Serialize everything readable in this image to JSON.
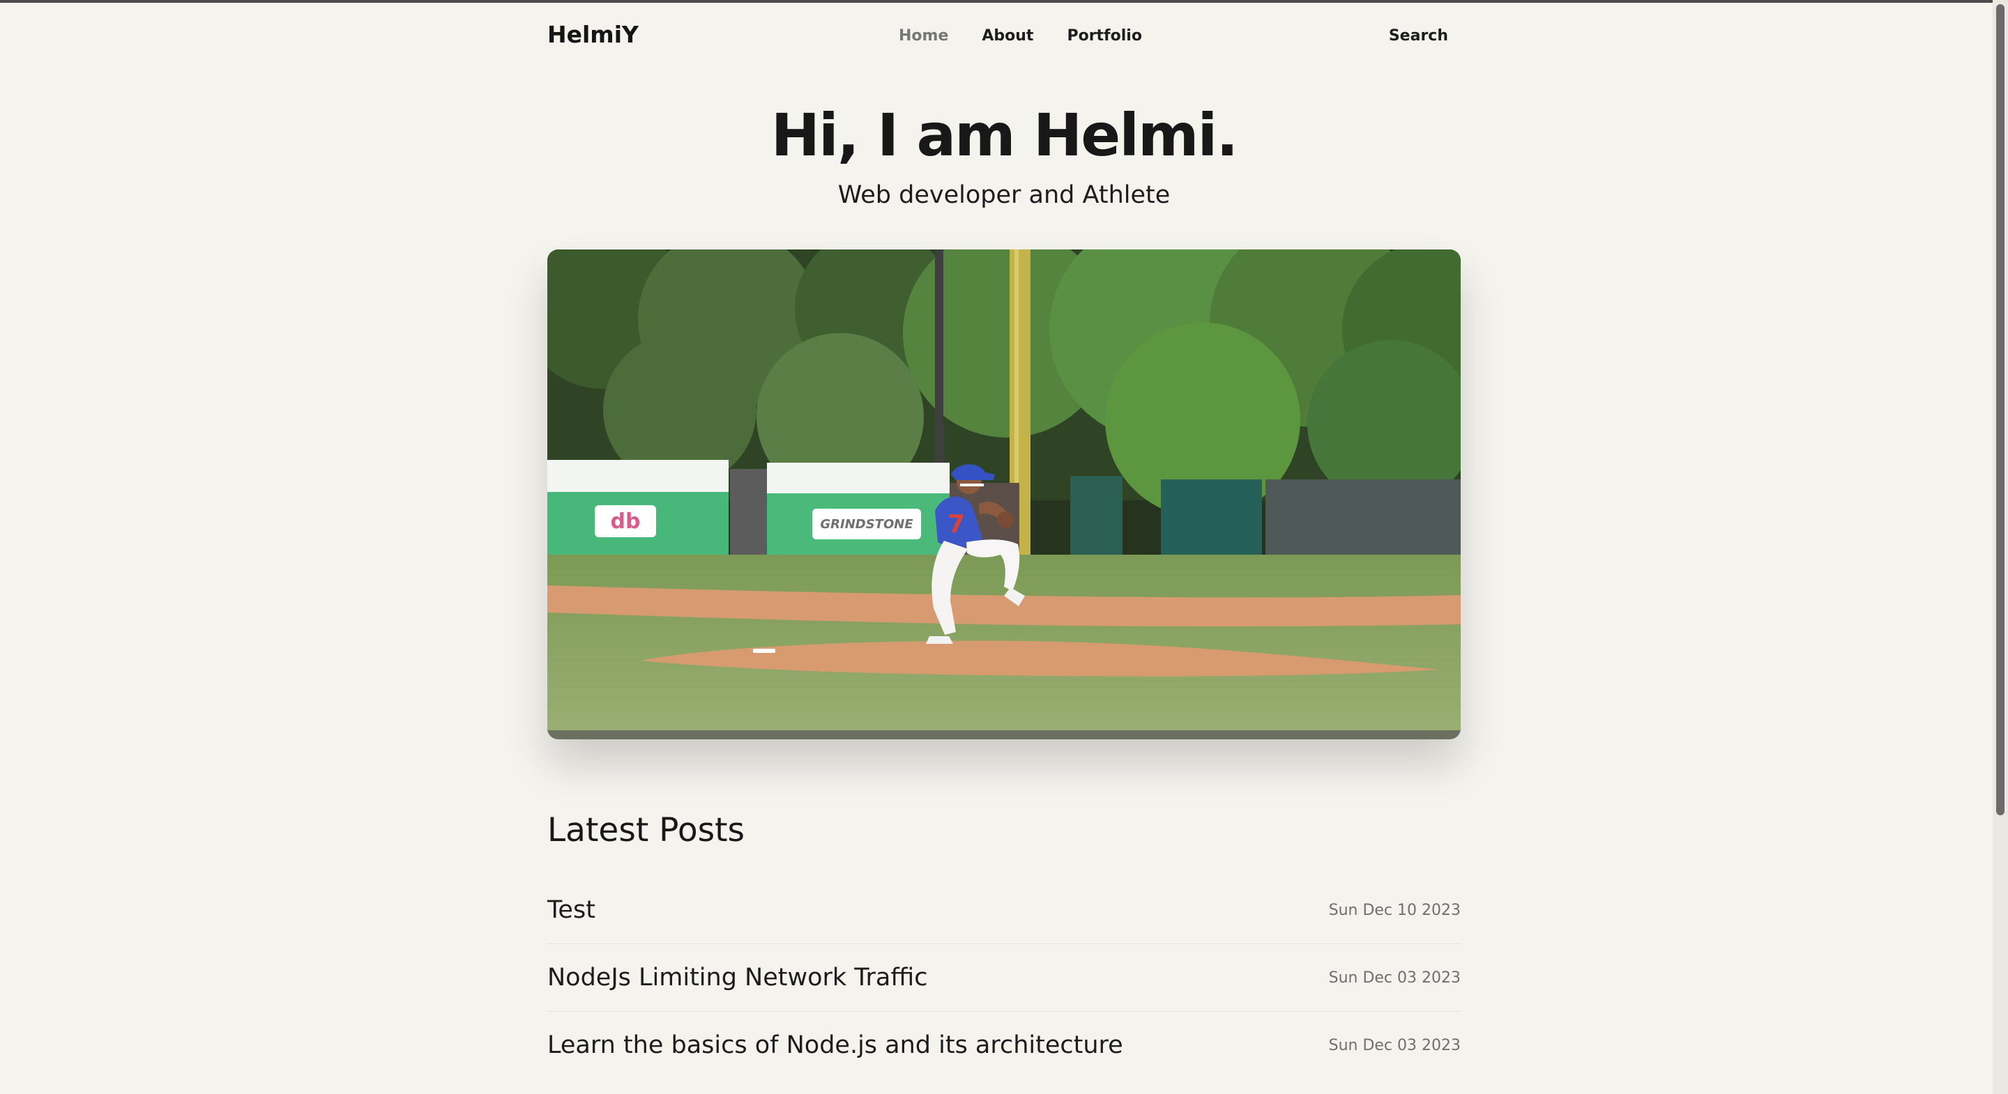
{
  "brand": {
    "name": "HelmiY"
  },
  "nav": {
    "home": "Home",
    "about": "About",
    "portfolio": "Portfolio",
    "search": "Search"
  },
  "hero": {
    "title": "Hi, I am Helmi.",
    "subtitle": "Web developer and Athlete",
    "banner_left_text": "db",
    "banner_right_text": "GRINDSTONE",
    "jersey_number": "7"
  },
  "posts": {
    "heading": "Latest Posts",
    "items": [
      {
        "title": "Test",
        "date": "Sun Dec 10 2023"
      },
      {
        "title": "NodeJs Limiting Network Traffic",
        "date": "Sun Dec 03 2023"
      },
      {
        "title": "Learn the basics of Node.js and its architecture",
        "date": "Sun Dec 03 2023"
      }
    ]
  },
  "colors": {
    "background": "#f5f3ee",
    "text": "#171717",
    "muted": "#777777"
  }
}
